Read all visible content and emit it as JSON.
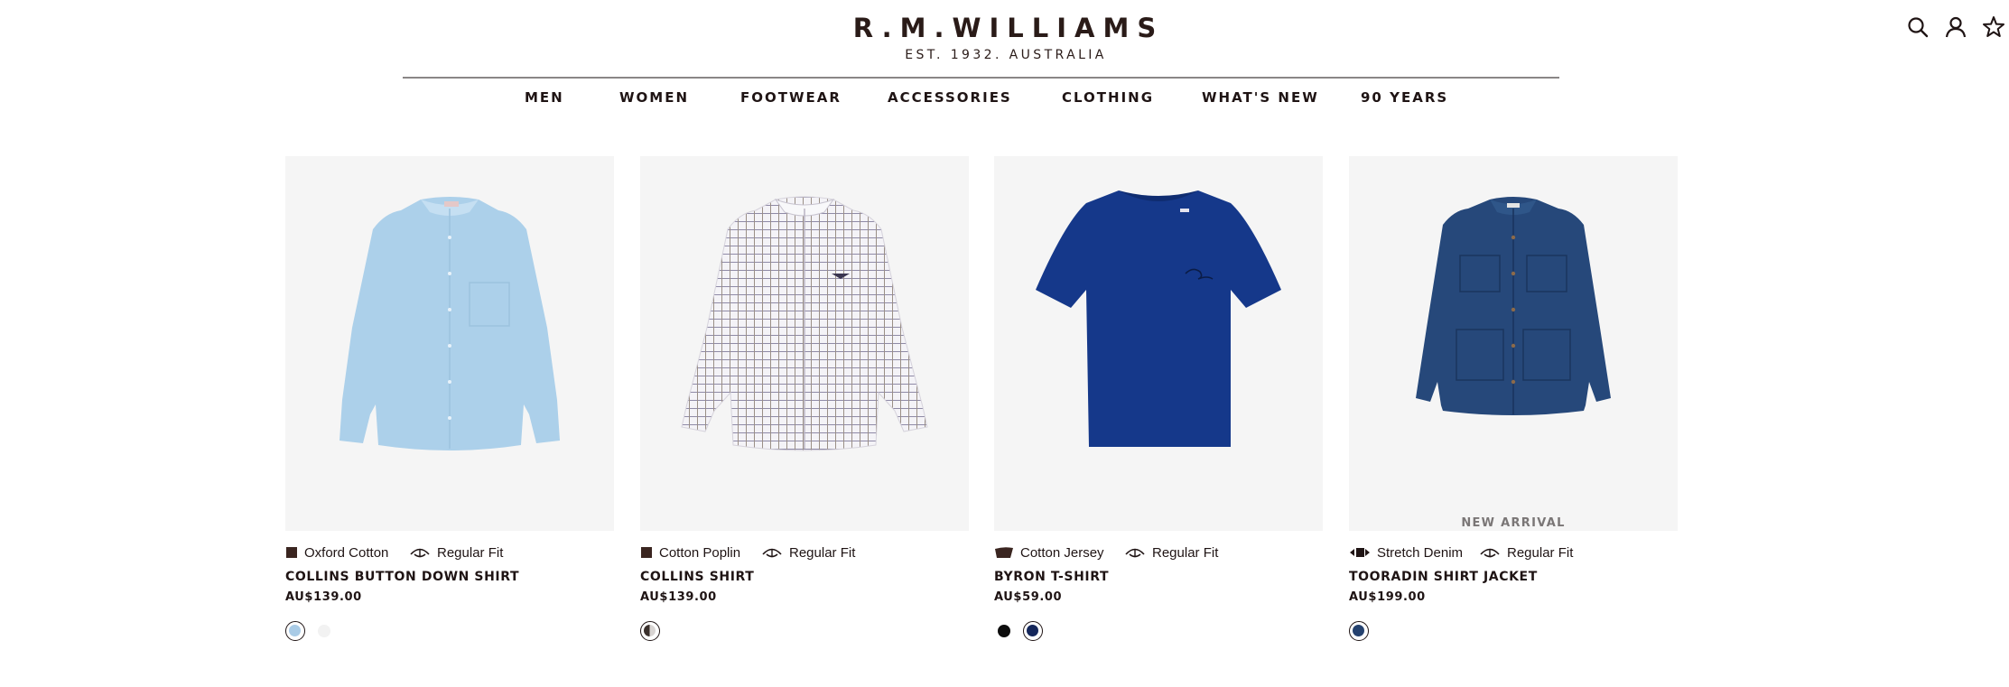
{
  "brand": {
    "name": "R.M.WILLIAMS",
    "tagline": "EST. 1932. AUSTRALIA"
  },
  "header_icons": [
    "search-icon",
    "account-icon",
    "wishlist-star-icon"
  ],
  "nav": {
    "items": [
      "MEN",
      "WOMEN",
      "FOOTWEAR",
      "ACCESSORIES",
      "CLOTHING",
      "WHAT'S NEW",
      "90 YEARS"
    ]
  },
  "products": [
    {
      "name": "COLLINS BUTTON DOWN SHIRT",
      "price": "AU$139.00",
      "fabric": "Oxford Cotton",
      "fit": "Regular Fit",
      "badge": "",
      "swatches": [
        {
          "color": "#a9cbe6",
          "selected": true
        },
        {
          "color": "#f2f2f2",
          "selected": false
        }
      ]
    },
    {
      "name": "COLLINS SHIRT",
      "price": "AU$139.00",
      "fabric": "Cotton Poplin",
      "fit": "Regular Fit",
      "badge": "",
      "swatches": [
        {
          "color": "#3a302c",
          "selected": true
        }
      ]
    },
    {
      "name": "BYRON T-SHIRT",
      "price": "AU$59.00",
      "fabric": "Cotton Jersey",
      "fit": "Regular Fit",
      "badge": "",
      "swatches": [
        {
          "color": "#0d0d0d",
          "selected": false
        },
        {
          "color": "#14265a",
          "selected": true
        }
      ]
    },
    {
      "name": "TOORADIN SHIRT JACKET",
      "price": "AU$199.00",
      "fabric": "Stretch Denim",
      "fit": "Regular Fit",
      "badge": "NEW ARRIVAL",
      "swatches": [
        {
          "color": "#24416e",
          "selected": true
        }
      ]
    }
  ],
  "colors": {
    "text": "#1f1414",
    "image_background": "#f5f5f5",
    "divider": "#8a8686"
  }
}
